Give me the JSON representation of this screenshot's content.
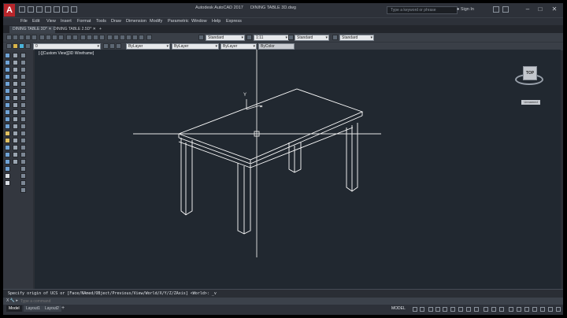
{
  "app": {
    "title": "Autodesk AutoCAD 2017",
    "file_name": "DINING TABLE 3D.dwg",
    "logo_letter": "A",
    "search_placeholder": "Type a keyword or phrase",
    "sign_in": "Sign In"
  },
  "menu": [
    "File",
    "Edit",
    "View",
    "Insert",
    "Format",
    "Tools",
    "Draw",
    "Dimension",
    "Modify",
    "Parametric",
    "Window",
    "Help",
    "Express"
  ],
  "file_tabs": [
    "DINING TABLE 3D*",
    "DINING TABLE 2.5D*"
  ],
  "toolbar1": {
    "text_style": "Standard",
    "dim_scale": "1:11",
    "table_style": "Standard",
    "mleader_style": "Standard"
  },
  "toolbar2": {
    "layer_value": "0",
    "color": "ByLayer",
    "linetype": "ByLayer",
    "lineweight": "ByLayer",
    "plot_style": "ByColor"
  },
  "viewport": {
    "label": "[-][Custom View][3D Wireframe]",
    "background": "#212830",
    "wire_color": "#ffffff",
    "crosshair_color": "#e8e8e8",
    "ucs_label": "Y"
  },
  "viewcube": {
    "face": "TOP",
    "ucs_menu": "Unnamed"
  },
  "command": {
    "history": "Specify origin of UCS or [Face/NAmed/OBject/Previous/View/World/X/Y/Z/ZAxis] <World>: _v",
    "prompt_prefix": "X 🔧 ▸",
    "input_placeholder": "Type a command"
  },
  "layout_tabs": [
    "Model",
    "Layout1",
    "Layout2"
  ],
  "status": {
    "model": "MODEL"
  }
}
